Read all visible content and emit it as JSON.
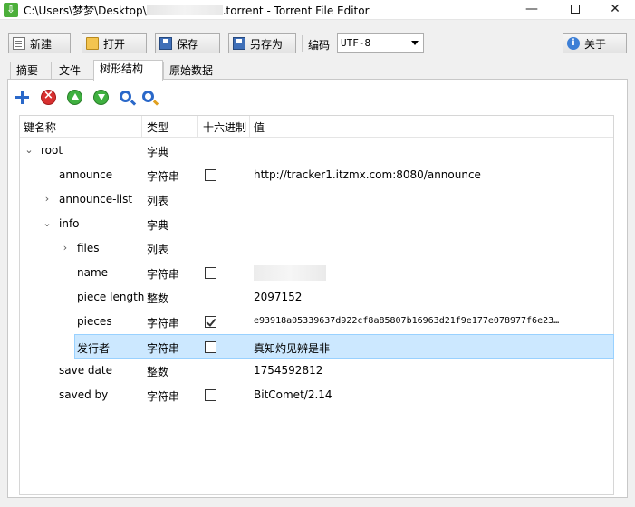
{
  "window": {
    "title_prefix": "C:\\Users\\梦梦\\Desktop\\",
    "title_suffix": ".torrent - Torrent File Editor",
    "minimize": "—",
    "close": "✕"
  },
  "toolbar": {
    "new_label": "新建",
    "open_label": "打开",
    "save_label": "保存",
    "save_as_label": "另存为",
    "encoding_label": "编码",
    "encoding_value": "UTF-8",
    "about_label": "关于"
  },
  "tabs": [
    {
      "label": "摘要"
    },
    {
      "label": "文件"
    },
    {
      "label": "树形结构"
    },
    {
      "label": "原始数据"
    }
  ],
  "tree": {
    "columns": {
      "name": "键名称",
      "type": "类型",
      "hex": "十六进制",
      "value": "值"
    },
    "rows": [
      {
        "name": "root",
        "type": "字典",
        "value": ""
      },
      {
        "name": "announce",
        "type": "字符串",
        "value": "http://tracker1.itzmx.com:8080/announce"
      },
      {
        "name": "announce-list",
        "type": "列表",
        "value": ""
      },
      {
        "name": "info",
        "type": "字典",
        "value": ""
      },
      {
        "name": "files",
        "type": "列表",
        "value": ""
      },
      {
        "name": "name",
        "type": "字符串",
        "value": ""
      },
      {
        "name": "piece length",
        "type": "整数",
        "value": "2097152"
      },
      {
        "name": "pieces",
        "type": "字符串",
        "value": "e93918a05339637d922cf8a85807b16963d21f9e177e078977f6e23…"
      },
      {
        "name": "发行者",
        "type": "字符串",
        "value": "真知灼见辨是非"
      },
      {
        "name": "save date",
        "type": "整数",
        "value": "1754592812"
      },
      {
        "name": "saved by",
        "type": "字符串",
        "value": "BitComet/2.14"
      }
    ]
  },
  "icons": {
    "app": "torrent-editor-app-icon",
    "add": "add-icon",
    "delete": "delete-icon",
    "move_up": "move-up-icon",
    "move_down": "move-down-icon",
    "find": "find-icon",
    "replace": "find-replace-icon"
  },
  "colors": {
    "selected_row": "#cce8ff",
    "selected_border": "#99d1ff"
  }
}
